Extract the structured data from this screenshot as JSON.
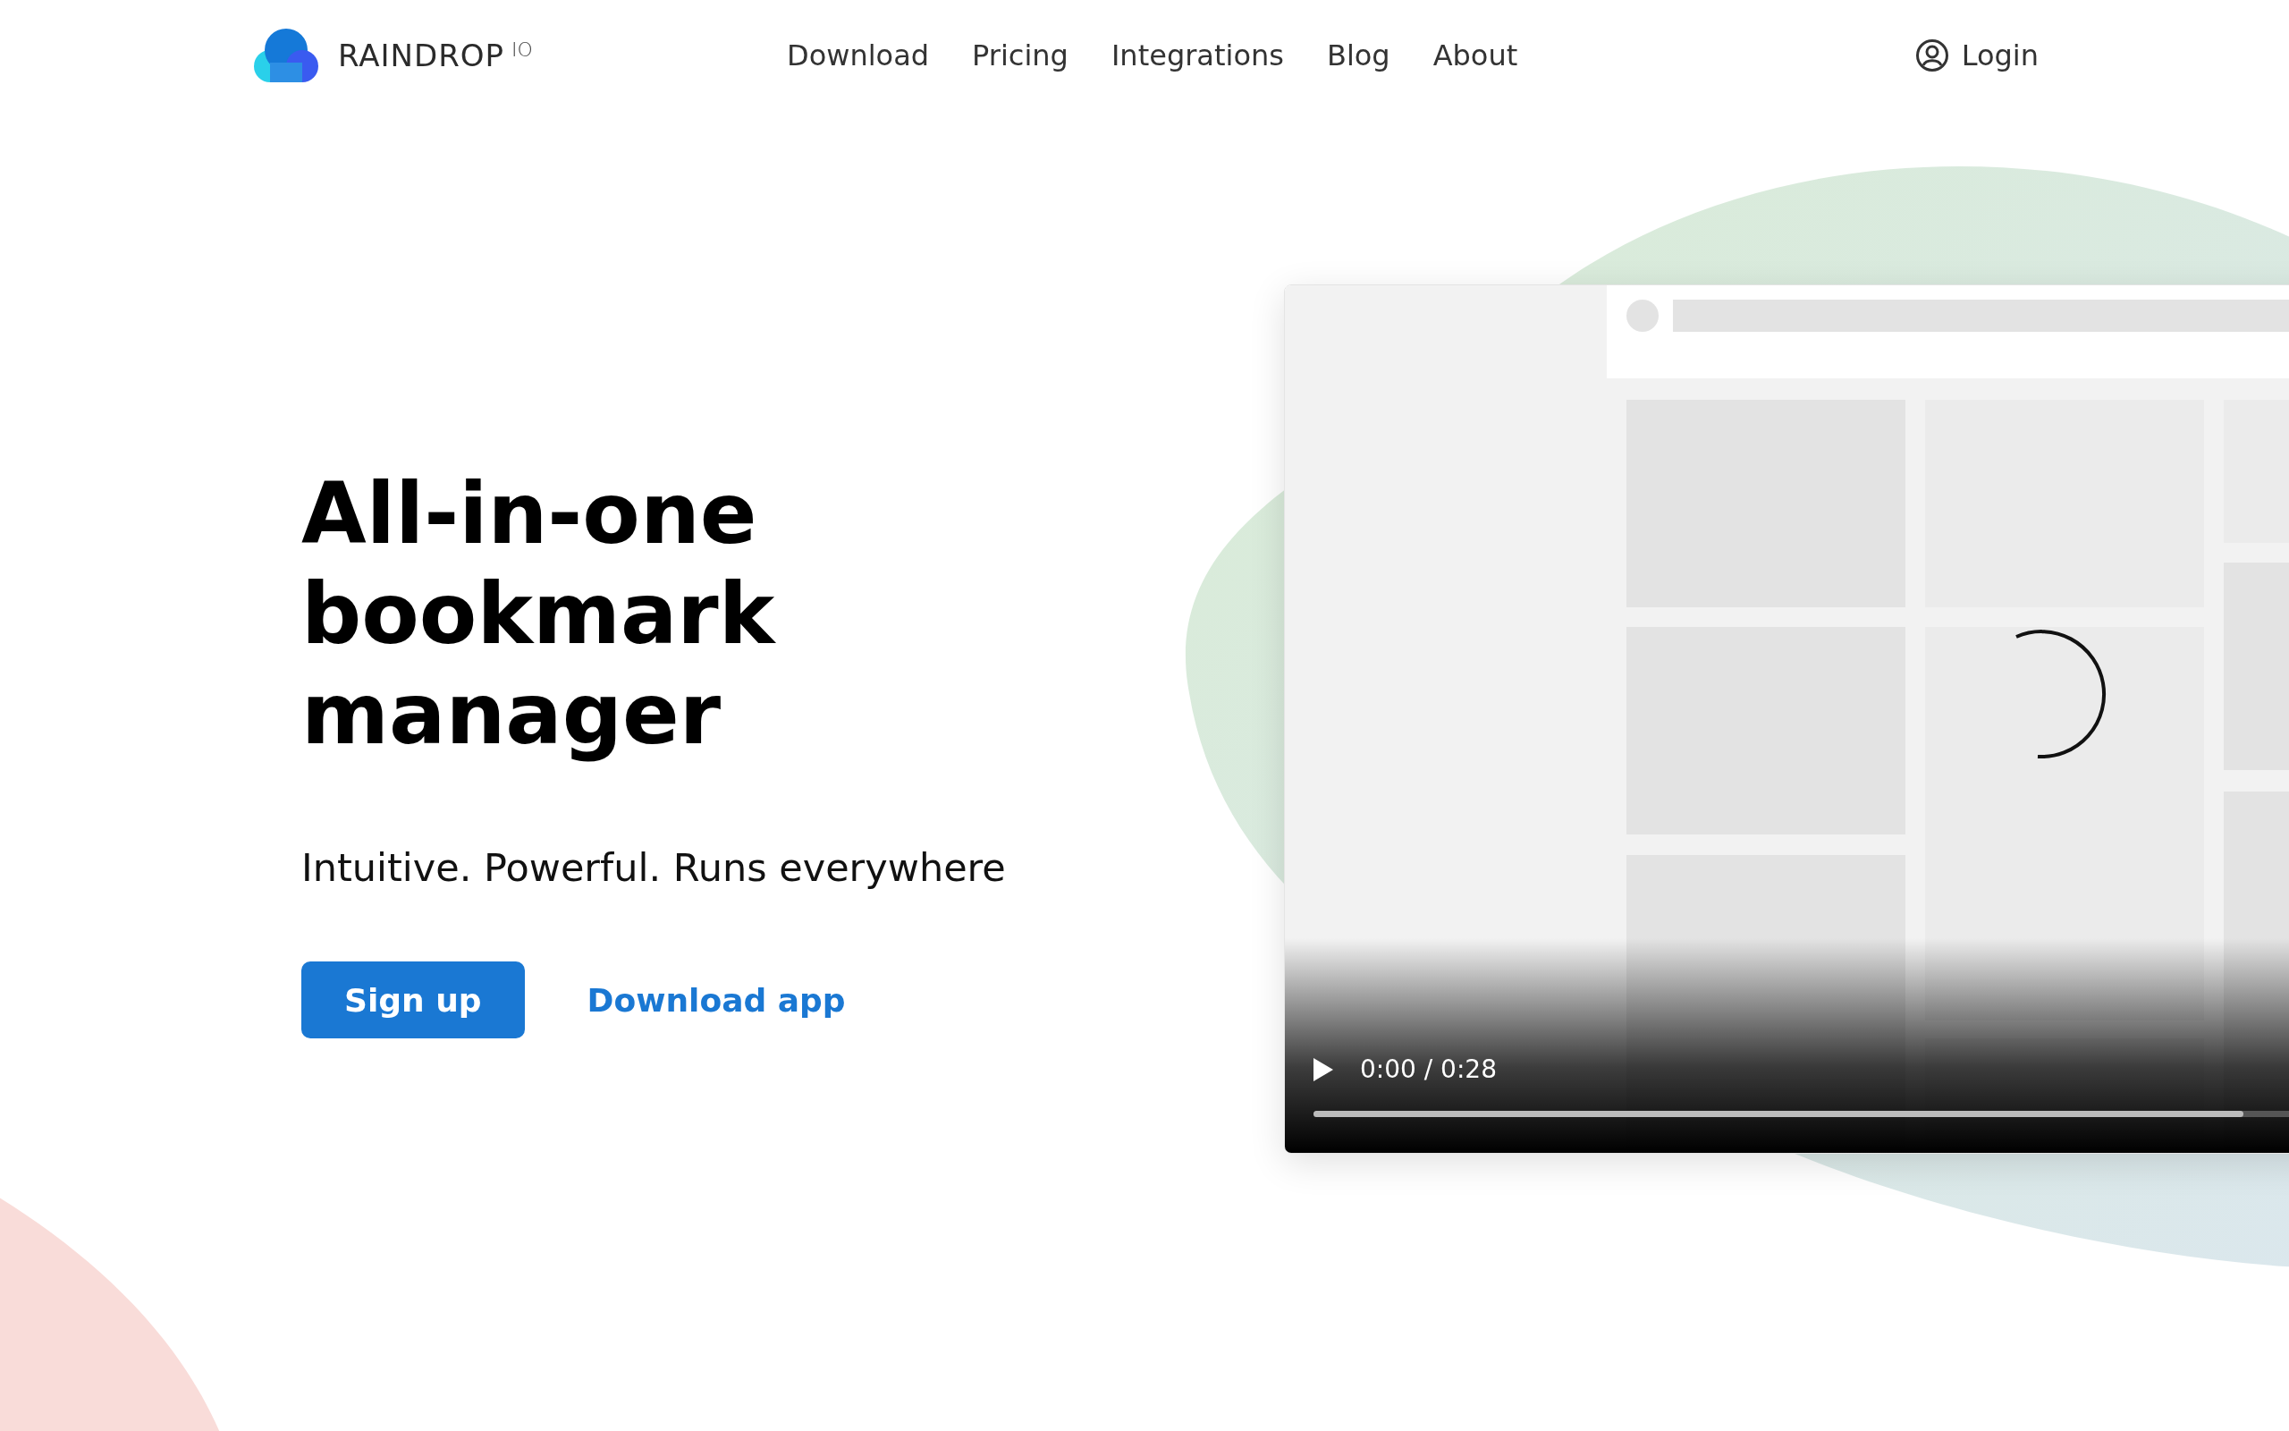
{
  "header": {
    "brand": {
      "name": "RAINDROP",
      "suffix": "IO"
    },
    "nav": [
      {
        "label": "Download"
      },
      {
        "label": "Pricing"
      },
      {
        "label": "Integrations"
      },
      {
        "label": "Blog"
      },
      {
        "label": "About"
      }
    ],
    "login": {
      "label": "Login"
    }
  },
  "hero": {
    "title_lines": [
      "All-in-one",
      "bookmark",
      "manager"
    ],
    "subtitle": "Intuitive. Powerful. Runs everywhere",
    "primary_button": "Sign up",
    "secondary_link": "Download app"
  },
  "video": {
    "time": "0:00 / 0:28",
    "progress": {
      "level": 0.82
    }
  }
}
